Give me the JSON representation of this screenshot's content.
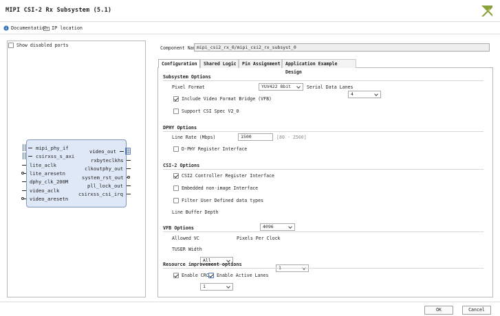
{
  "window": {
    "title": "MIPI CSI-2 Rx Subsystem (5.1)"
  },
  "toolbar": {
    "documentation": "Documentation",
    "ip_location": "IP location"
  },
  "left_panel": {
    "show_disabled_ports": "Show disabled ports",
    "block": {
      "left_ports": [
        "mipi_phy_if",
        "csirxss_s_axi",
        "lite_aclk",
        "lite_aresetn",
        "dphy_clk_200M",
        "video_aclk",
        "video_aresetn"
      ],
      "right_ports": [
        "video_out",
        "rxbyteclkhs",
        "clkoutphy_out",
        "system_rst_out",
        "pll_lock_out",
        "csirxss_csi_irq"
      ]
    }
  },
  "component": {
    "label": "Component Name",
    "value": "mipi_csi2_rx_0/mipi_csi2_rx_subsyst_0"
  },
  "tabs": [
    "Configuration",
    "Shared Logic",
    "Pin Assignment",
    "Application Example Design"
  ],
  "config": {
    "subsystem": {
      "title": "Subsystem Options",
      "pixel_format_label": "Pixel Format",
      "pixel_format_value": "YUV422 8bit",
      "serial_lanes_label": "Serial Data Lanes",
      "serial_lanes_value": "4",
      "vfb_label": "Include Video Format Bridge (VFB)",
      "csi_v2_label": "Support CSI Spec V2_0"
    },
    "dphy": {
      "title": "DPHY Options",
      "line_rate_label": "Line Rate (Mbps)",
      "line_rate_value": "1500",
      "line_rate_range": "[80 - 2500]",
      "register_label": "D-PHY Register Interface"
    },
    "csi2": {
      "title": "CSI-2 Options",
      "controller_label": "CSI2 Controller Register Interface",
      "embedded_label": "Embedded non-image Interface",
      "filter_label": "Filter User Defined data types",
      "buffer_label": "Line Buffer Depth",
      "buffer_value": "4096"
    },
    "vfb": {
      "title": "VFB Options",
      "allowed_vc_label": "Allowed VC",
      "allowed_vc_value": "All",
      "ppc_label": "Pixels Per Clock",
      "ppc_value": "1",
      "tuser_label": "TUSER Width",
      "tuser_value": "1"
    },
    "resource": {
      "title": "Resource improvement options",
      "crc_label": "Enable CRC",
      "active_lanes_label": "Enable Active Lanes"
    }
  },
  "footer": {
    "ok": "OK",
    "cancel": "Cancel"
  }
}
